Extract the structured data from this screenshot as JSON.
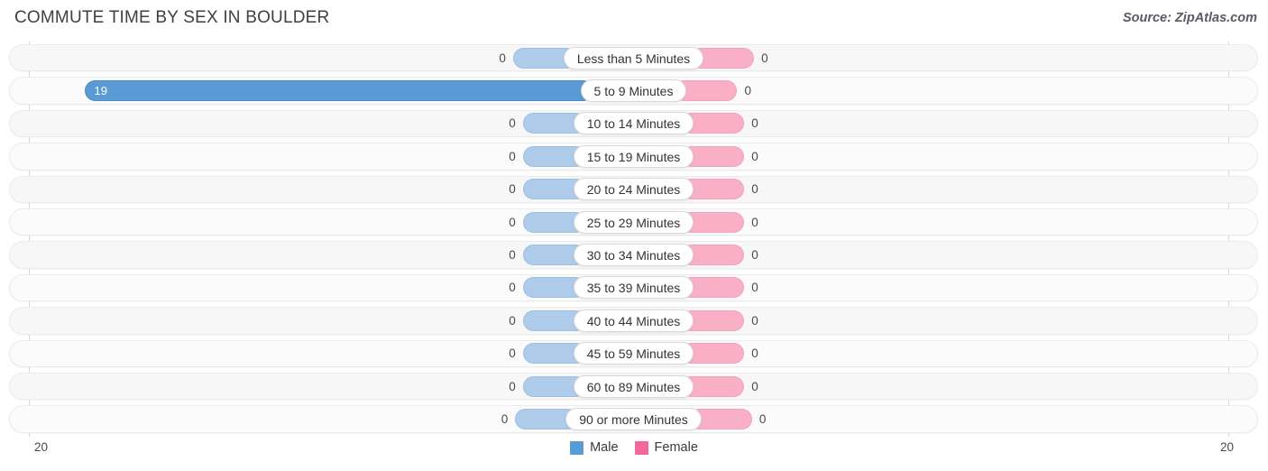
{
  "header": {
    "title": "COMMUTE TIME BY SEX IN BOULDER",
    "source": "Source: ZipAtlas.com"
  },
  "axis": {
    "left_tick": "20",
    "right_tick": "20"
  },
  "legend": {
    "items": [
      {
        "label": "Male",
        "color": "#5b9bd5",
        "key": "male"
      },
      {
        "label": "Female",
        "color": "#f4679b",
        "key": "female"
      }
    ]
  },
  "colors": {
    "male_filled": "#5b9bd5",
    "male_zero": "#aecbea",
    "female_filled": "#f4679b",
    "female_zero": "#f9afc6",
    "track": "#f7f7f7",
    "label_bg": "#ffffff"
  },
  "chart_data": {
    "type": "bar",
    "title": "COMMUTE TIME BY SEX IN BOULDER",
    "xlabel": "",
    "ylabel": "",
    "orientation": "horizontal-diverging",
    "xlim": [
      20,
      20
    ],
    "grid": false,
    "legend_position": "bottom-center",
    "categories": [
      "Less than 5 Minutes",
      "5 to 9 Minutes",
      "10 to 14 Minutes",
      "15 to 19 Minutes",
      "20 to 24 Minutes",
      "25 to 29 Minutes",
      "30 to 34 Minutes",
      "35 to 39 Minutes",
      "40 to 44 Minutes",
      "45 to 59 Minutes",
      "60 to 89 Minutes",
      "90 or more Minutes"
    ],
    "series": [
      {
        "name": "Male",
        "values": [
          0,
          19,
          0,
          0,
          0,
          0,
          0,
          0,
          0,
          0,
          0,
          0
        ]
      },
      {
        "name": "Female",
        "values": [
          0,
          0,
          0,
          0,
          0,
          0,
          0,
          0,
          0,
          0,
          0,
          0
        ]
      }
    ]
  },
  "rows": [
    {
      "label": "Less than 5 Minutes",
      "male": "0",
      "female": "0",
      "male_pct": 0,
      "female_pct": 0
    },
    {
      "label": "5 to 9 Minutes",
      "male": "19",
      "female": "0",
      "male_pct": 95,
      "female_pct": 0
    },
    {
      "label": "10 to 14 Minutes",
      "male": "0",
      "female": "0",
      "male_pct": 0,
      "female_pct": 0
    },
    {
      "label": "15 to 19 Minutes",
      "male": "0",
      "female": "0",
      "male_pct": 0,
      "female_pct": 0
    },
    {
      "label": "20 to 24 Minutes",
      "male": "0",
      "female": "0",
      "male_pct": 0,
      "female_pct": 0
    },
    {
      "label": "25 to 29 Minutes",
      "male": "0",
      "female": "0",
      "male_pct": 0,
      "female_pct": 0
    },
    {
      "label": "30 to 34 Minutes",
      "male": "0",
      "female": "0",
      "male_pct": 0,
      "female_pct": 0
    },
    {
      "label": "35 to 39 Minutes",
      "male": "0",
      "female": "0",
      "male_pct": 0,
      "female_pct": 0
    },
    {
      "label": "40 to 44 Minutes",
      "male": "0",
      "female": "0",
      "male_pct": 0,
      "female_pct": 0
    },
    {
      "label": "45 to 59 Minutes",
      "male": "0",
      "female": "0",
      "male_pct": 0,
      "female_pct": 0
    },
    {
      "label": "60 to 89 Minutes",
      "male": "0",
      "female": "0",
      "male_pct": 0,
      "female_pct": 0
    },
    {
      "label": "90 or more Minutes",
      "male": "0",
      "female": "0",
      "male_pct": 0,
      "female_pct": 0
    }
  ]
}
